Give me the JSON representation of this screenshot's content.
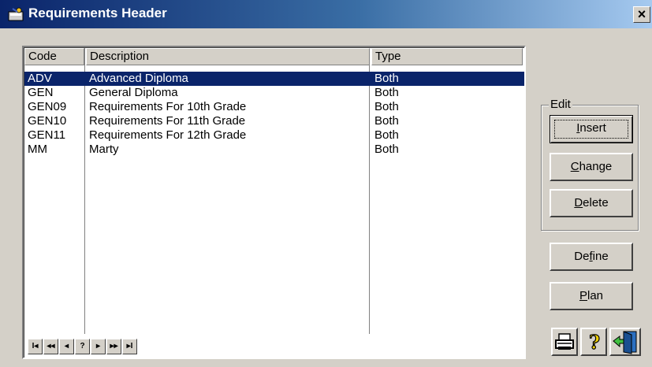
{
  "window": {
    "title": "Requirements Header",
    "close_glyph": "×"
  },
  "grid": {
    "columns": [
      "Code",
      "Description",
      "Type"
    ],
    "rows": [
      {
        "code": "ADV",
        "description": "Advanced Diploma",
        "type": "Both",
        "selected": true
      },
      {
        "code": "GEN",
        "description": "General Diploma",
        "type": "Both"
      },
      {
        "code": "GEN09",
        "description": "Requirements For 10th Grade",
        "type": "Both"
      },
      {
        "code": "GEN10",
        "description": "Requirements For 11th Grade",
        "type": "Both"
      },
      {
        "code": "GEN11",
        "description": "Requirements For 12th Grade",
        "type": "Both"
      },
      {
        "code": "MM",
        "description": "Marty",
        "type": "Both"
      }
    ],
    "nav": [
      "I◂",
      "◂◂",
      "◂",
      "?",
      "▸",
      "▸▸",
      "▸I"
    ]
  },
  "edit_group": {
    "label": "Edit",
    "insert": {
      "pre": "",
      "key": "I",
      "post": "nsert"
    },
    "change": {
      "pre": "",
      "key": "C",
      "post": "hange"
    },
    "delete": {
      "pre": "",
      "key": "D",
      "post": "elete"
    }
  },
  "define": {
    "pre": "De",
    "key": "f",
    "post": "ine"
  },
  "plan": {
    "pre": "",
    "key": "P",
    "post": "lan"
  },
  "icons": {
    "print": "printer-icon",
    "help": "help-icon",
    "exit": "exit-door-icon"
  },
  "colors": {
    "selection": "#0a246a",
    "titlebar": "#0a246a",
    "face": "#d4d0c8"
  }
}
